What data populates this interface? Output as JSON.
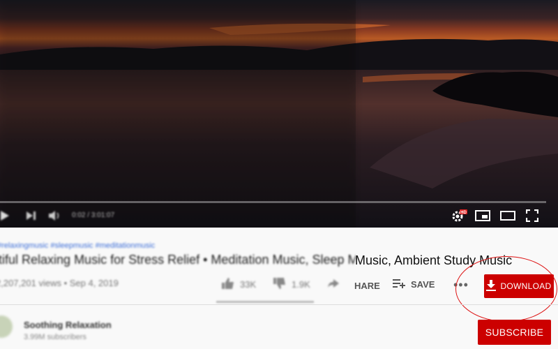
{
  "video": {
    "scene": "blurred sunset over a lake",
    "time": "0:02 / 3:01:07",
    "progress": 0.0,
    "hd_badge": "HD"
  },
  "info": {
    "hashtags": "#relaxingmusic #sleepmusic #meditationmusic",
    "title_blurred": "utiful Relaxing Music for Stress Relief • Meditation Music, Sleep M",
    "title_visible": "Music, Ambient Study Music",
    "views": "2,207,201 views • Sep 4, 2019",
    "likes": "33K",
    "dislikes": "1.9K",
    "share_label": "HARE",
    "save_label": "SAVE",
    "more_label": "•••",
    "download_label": "DOWNLOAD"
  },
  "channel": {
    "name": "Soothing Relaxation",
    "subscribers": "3.99M subscribers",
    "subscribe_label": "SUBSCRIBE"
  },
  "colors": {
    "accent": "#cc0000",
    "highlight": "#dd1111",
    "link": "#3e6fd8"
  },
  "icons": [
    "play-icon",
    "next-icon",
    "volume-icon",
    "settings-icon",
    "miniplayer-icon",
    "theater-icon",
    "fullscreen-icon",
    "like-icon",
    "dislike-icon",
    "share-icon",
    "save-playlist-icon",
    "more-icon",
    "download-icon"
  ]
}
